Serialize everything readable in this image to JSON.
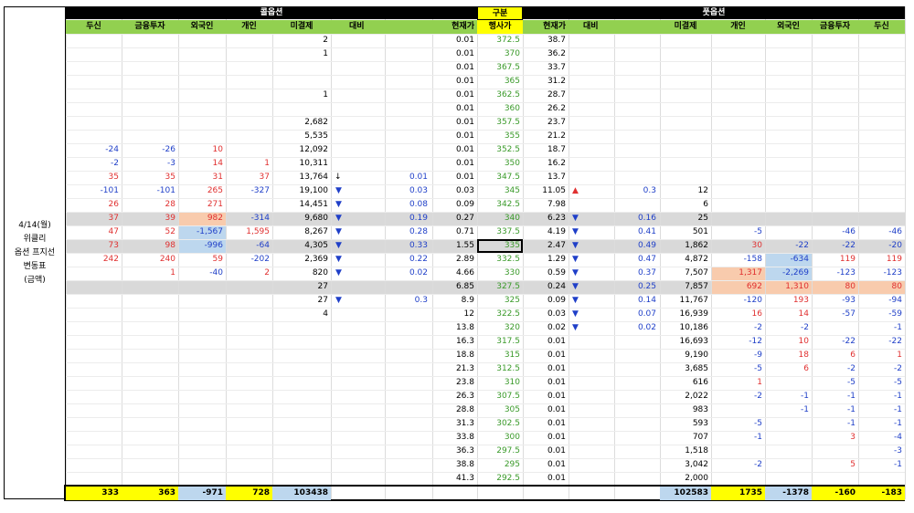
{
  "left_label": [
    "4/14(월)",
    "위클리",
    "옵션 프지선",
    "변동표",
    "(금액)"
  ],
  "section": {
    "call": "콜옵션",
    "center": "구분",
    "put": "풋옵션"
  },
  "headers": {
    "call": [
      "두신",
      "금융투자",
      "외국인",
      "개인",
      "미결제",
      "대비"
    ],
    "center": [
      "현재가",
      "행사가",
      "현재가"
    ],
    "put": [
      "대비",
      "미결제",
      "개인",
      "외국인",
      "금융투자",
      "두신"
    ]
  },
  "rows": [
    {
      "cc": "0.01",
      "k": "372.5",
      "pc": "38.7",
      "c_oi": "2"
    },
    {
      "cc": "0.01",
      "k": "370",
      "pc": "36.2",
      "c_oi": "1"
    },
    {
      "cc": "0.01",
      "k": "367.5",
      "pc": "33.7"
    },
    {
      "cc": "0.01",
      "k": "365",
      "pc": "31.2"
    },
    {
      "cc": "0.01",
      "k": "362.5",
      "pc": "28.7",
      "c_oi": "1"
    },
    {
      "cc": "0.01",
      "k": "360",
      "pc": "26.2"
    },
    {
      "cc": "0.01",
      "k": "357.5",
      "pc": "23.7",
      "c_oi": "2,682"
    },
    {
      "cc": "0.01",
      "k": "355",
      "pc": "21.2",
      "c_oi": "5,535"
    },
    {
      "cc": "0.01",
      "k": "352.5",
      "pc": "18.7",
      "c_du": "-24",
      "c_fi": "-26",
      "c_fo": "10",
      "c_oi": "12,092"
    },
    {
      "cc": "0.01",
      "k": "350",
      "pc": "16.2",
      "c_du": "-2",
      "c_fi": "-3",
      "c_fo": "14",
      "c_in": "1",
      "c_oi": "10,311"
    },
    {
      "cc": "0.01",
      "k": "347.5",
      "pc": "13.7",
      "c_du": "35",
      "c_fi": "35",
      "c_fo": "31",
      "c_in": "37",
      "c_oi": "13,764",
      "c_ch": "0.01"
    },
    {
      "cc": "0.03",
      "k": "345",
      "pc": "11.05",
      "c_du": "-101",
      "c_fi": "-101",
      "c_fo": "265",
      "c_in": "-327",
      "c_oi": "19,100",
      "c_ch": "0.03",
      "p_ch": "0.3",
      "p_oi": "12"
    },
    {
      "cc": "0.09",
      "k": "342.5",
      "pc": "7.98",
      "c_du": "26",
      "c_fi": "28",
      "c_fo": "271",
      "c_oi": "14,451",
      "c_ch": "0.08",
      "p_oi": "6"
    },
    {
      "cc": "0.27",
      "k": "340",
      "pc": "6.23",
      "c_du": "37",
      "c_fi": "39",
      "c_fo": "982",
      "c_in": "-314",
      "c_oi": "9,680",
      "c_ch": "0.19",
      "p_ch": "0.16",
      "p_oi": "25"
    },
    {
      "cc": "0.71",
      "k": "337.5",
      "pc": "4.19",
      "c_du": "47",
      "c_fi": "52",
      "c_fo": "-1,567",
      "c_in": "1,595",
      "c_oi": "8,267",
      "c_ch": "0.28",
      "p_ch": "0.41",
      "p_oi": "501",
      "p_in": "-5",
      "p_fi": "-46",
      "p_du": "-46"
    },
    {
      "cc": "1.55",
      "k": "335",
      "pc": "2.47",
      "c_du": "73",
      "c_fi": "98",
      "c_fo": "-996",
      "c_in": "-64",
      "c_oi": "4,305",
      "c_ch": "0.33",
      "p_ch": "0.49",
      "p_oi": "1,862",
      "p_in": "30",
      "p_fo": "-22",
      "p_fi": "-22",
      "p_du": "-20"
    },
    {
      "cc": "2.89",
      "k": "332.5",
      "pc": "1.29",
      "c_du": "242",
      "c_fi": "240",
      "c_fo": "59",
      "c_in": "-202",
      "c_oi": "2,369",
      "c_ch": "0.22",
      "p_ch": "0.47",
      "p_oi": "4,872",
      "p_in": "-158",
      "p_fo": "-634",
      "p_fi": "119",
      "p_du": "119"
    },
    {
      "cc": "4.66",
      "k": "330",
      "pc": "0.59",
      "c_fi": "1",
      "c_fo": "-40",
      "c_in": "2",
      "c_oi": "820",
      "c_ch": "0.02",
      "p_ch": "0.37",
      "p_oi": "7,507",
      "p_in": "1,317",
      "p_fo": "-2,269",
      "p_fi": "-123",
      "p_du": "-123"
    },
    {
      "cc": "6.85",
      "k": "327.5",
      "pc": "0.24",
      "c_oi": "27",
      "p_ch": "0.25",
      "p_oi": "7,857",
      "p_in": "692",
      "p_fo": "1,310",
      "p_fi": "80",
      "p_du": "80"
    },
    {
      "cc": "8.9",
      "k": "325",
      "pc": "0.09",
      "c_oi": "27",
      "c_ch": "0.3",
      "p_ch": "0.14",
      "p_oi": "11,767",
      "p_in": "-120",
      "p_fo": "193",
      "p_fi": "-93",
      "p_du": "-94"
    },
    {
      "cc": "12",
      "k": "322.5",
      "pc": "0.03",
      "c_oi": "4",
      "p_ch": "0.07",
      "p_oi": "16,939",
      "p_in": "16",
      "p_fo": "14",
      "p_fi": "-57",
      "p_du": "-59"
    },
    {
      "cc": "13.8",
      "k": "320",
      "pc": "0.02",
      "p_ch": "0.02",
      "p_oi": "10,186",
      "p_in": "-2",
      "p_fo": "-2",
      "p_du": "-1"
    },
    {
      "cc": "16.3",
      "k": "317.5",
      "pc": "0.01",
      "p_oi": "16,693",
      "p_in": "-12",
      "p_fo": "10",
      "p_fi": "-22",
      "p_du": "-22"
    },
    {
      "cc": "18.8",
      "k": "315",
      "pc": "0.01",
      "p_oi": "9,190",
      "p_in": "-9",
      "p_fo": "18",
      "p_fi": "6",
      "p_du": "1"
    },
    {
      "cc": "21.3",
      "k": "312.5",
      "pc": "0.01",
      "p_oi": "3,685",
      "p_in": "-5",
      "p_fo": "6",
      "p_fi": "-2",
      "p_du": "-2"
    },
    {
      "cc": "23.8",
      "k": "310",
      "pc": "0.01",
      "p_oi": "616",
      "p_in": "1",
      "p_fi": "-5",
      "p_du": "-5"
    },
    {
      "cc": "26.3",
      "k": "307.5",
      "pc": "0.01",
      "p_oi": "2,022",
      "p_in": "-2",
      "p_fo": "-1",
      "p_fi": "-1",
      "p_du": "-1"
    },
    {
      "cc": "28.8",
      "k": "305",
      "pc": "0.01",
      "p_oi": "983",
      "p_fo": "-1",
      "p_fi": "-1",
      "p_du": "-1"
    },
    {
      "cc": "31.3",
      "k": "302.5",
      "pc": "0.01",
      "p_oi": "593",
      "p_in": "-5",
      "p_fi": "-1",
      "p_du": "-1"
    },
    {
      "cc": "33.8",
      "k": "300",
      "pc": "0.01",
      "p_oi": "707",
      "p_in": "-1",
      "p_fi": "3",
      "p_du": "-4"
    },
    {
      "cc": "36.3",
      "k": "297.5",
      "pc": "0.01",
      "p_oi": "1,518",
      "p_du": "-3"
    },
    {
      "cc": "38.8",
      "k": "295",
      "pc": "0.01",
      "p_oi": "3,042",
      "p_in": "-2",
      "p_fi": "5",
      "p_du": "-1"
    },
    {
      "cc": "41.3",
      "k": "292.5",
      "pc": "0.01",
      "p_oi": "2,000"
    }
  ],
  "totals": {
    "c_du": "333",
    "c_fi": "363",
    "c_fo": "-971",
    "c_in": "728",
    "c_oi": "103438",
    "p_oi": "102583",
    "p_in": "1735",
    "p_fo": "-1378",
    "p_fi": "-160",
    "p_du": "-183"
  },
  "colors": {
    "header_black": "#000000",
    "header_green": "#92d050",
    "yellow": "#ffff00",
    "salmon": "#f8cbad",
    "light_blue": "#bdd7ee",
    "gray_row": "#d9d9d9",
    "red": "#e03030",
    "blue": "#1f3fc8",
    "green": "#3a9a2a"
  },
  "icons": {
    "down_triangle": "▼",
    "up_triangle": "▲",
    "down_arrow": "↓"
  }
}
